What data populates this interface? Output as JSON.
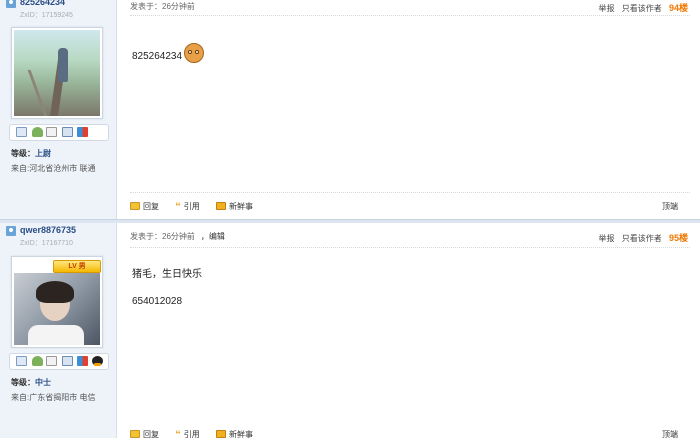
{
  "posts": [
    {
      "username": "825264234",
      "zxid": "ZxID：17159245",
      "level_label": "等级：",
      "level_value": "上尉",
      "from": "来自:河北省沧州市 联通",
      "posted_at": "发表于：26分钟前",
      "report": "举报",
      "only_author": "只看该作者",
      "floor": "94楼",
      "content_lines": [
        "825264234"
      ],
      "has_emoji": true,
      "has_vip_badge": false,
      "actions": {
        "reply": "回复",
        "quote": "引用",
        "news": "新鲜事"
      },
      "top": "顶端",
      "icon_buttons": [
        "mail-icon",
        "add-friend-icon",
        "profile-doc-icon",
        "card-icon",
        "gift-icon"
      ]
    },
    {
      "username": "qwer8876735",
      "zxid": "ZxID：17167710",
      "level_label": "等级：",
      "level_value": "中士",
      "from": "来自:广东省揭阳市 电信",
      "posted_at": "发表于：26分钟前",
      "edit": "，编辑",
      "report": "举报",
      "only_author": "只看该作者",
      "floor": "95楼",
      "content_lines": [
        "猪毛，生日快乐",
        "654012028"
      ],
      "vip_badge": "LV 男",
      "actions": {
        "reply": "回复",
        "quote": "引用",
        "news": "新鲜事"
      },
      "top": "顶端",
      "icon_buttons": [
        "mail-icon",
        "add-friend-icon",
        "profile-doc-icon",
        "card-icon",
        "qq-icon"
      ]
    }
  ]
}
